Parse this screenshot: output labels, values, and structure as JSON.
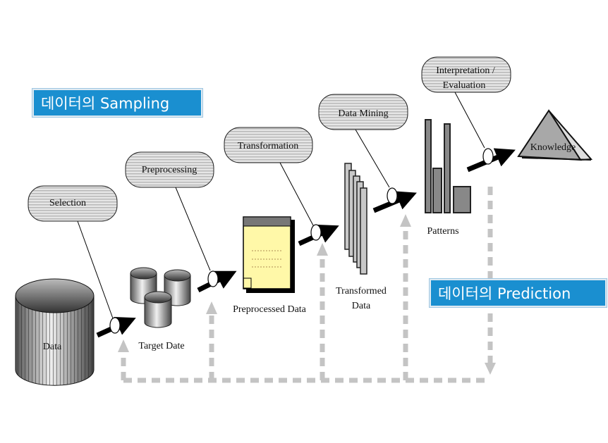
{
  "banners": {
    "sampling": "데이터의 Sampling",
    "prediction": "데이터의 Prediction"
  },
  "steps": [
    "Selection",
    "Preprocessing",
    "Transformation",
    "Data Mining",
    "Interpretation /",
    "Evaluation"
  ],
  "stages": {
    "data": "Data",
    "target": "Target Date",
    "preprocessed": "Preprocessed Data",
    "transformed_1": "Transformed",
    "transformed_2": "Data",
    "patterns": "Patterns",
    "knowledge": "Knowledge"
  },
  "colors": {
    "banner": "#1a8fd0",
    "arrow": "#000000",
    "feedback": "#bdbdbd",
    "document": "#fff8a8"
  }
}
